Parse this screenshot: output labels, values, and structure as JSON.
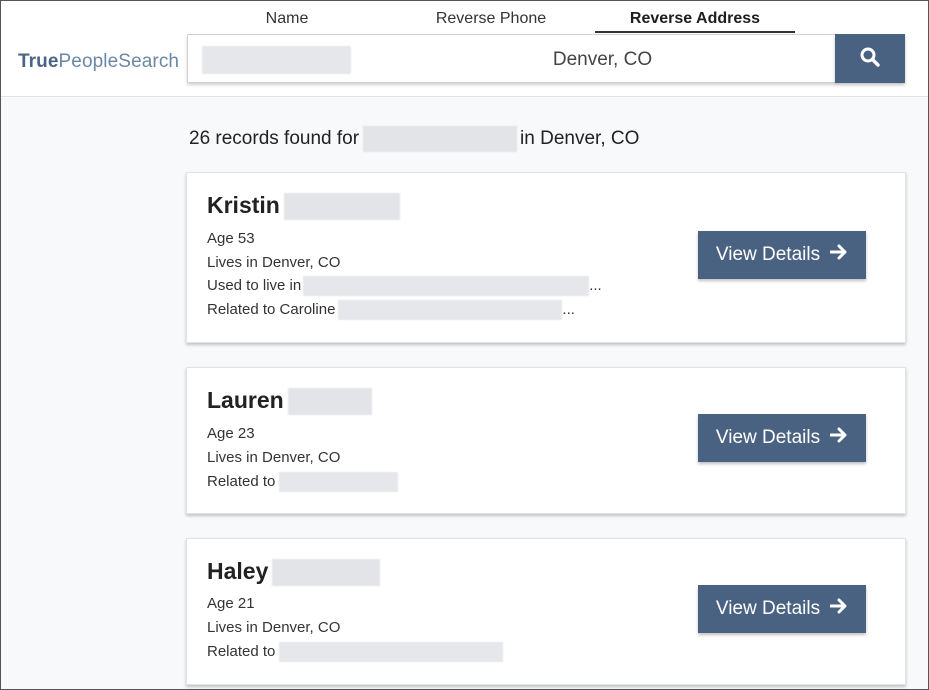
{
  "logo": {
    "bold": "True",
    "rest": "PeopleSearch"
  },
  "tabs": [
    {
      "label": "Name"
    },
    {
      "label": "Reverse Phone"
    },
    {
      "label": "Reverse Address"
    }
  ],
  "search": {
    "location_value": "Denver, CO"
  },
  "results": {
    "prefix": "26 records found for",
    "suffix": "in Denver, CO"
  },
  "colors": {
    "accent": "#4a6282",
    "logo": "#6b87a6"
  },
  "icons": {
    "search": "search-icon",
    "arrow": "arrow-right-icon"
  },
  "cards": [
    {
      "first_name": "Kristin",
      "age": "Age 53",
      "lives": "Lives in Denver, CO",
      "used_prefix": "Used to live in",
      "used_suffix": "...",
      "related_prefix": "Related to Caroline",
      "related_suffix": "...",
      "button": "View Details"
    },
    {
      "first_name": "Lauren",
      "age": "Age 23",
      "lives": "Lives in Denver, CO",
      "related_prefix": "Related to",
      "button": "View Details"
    },
    {
      "first_name": "Haley",
      "age": "Age 21",
      "lives": "Lives in Denver, CO",
      "related_prefix": "Related to",
      "button": "View Details"
    }
  ]
}
